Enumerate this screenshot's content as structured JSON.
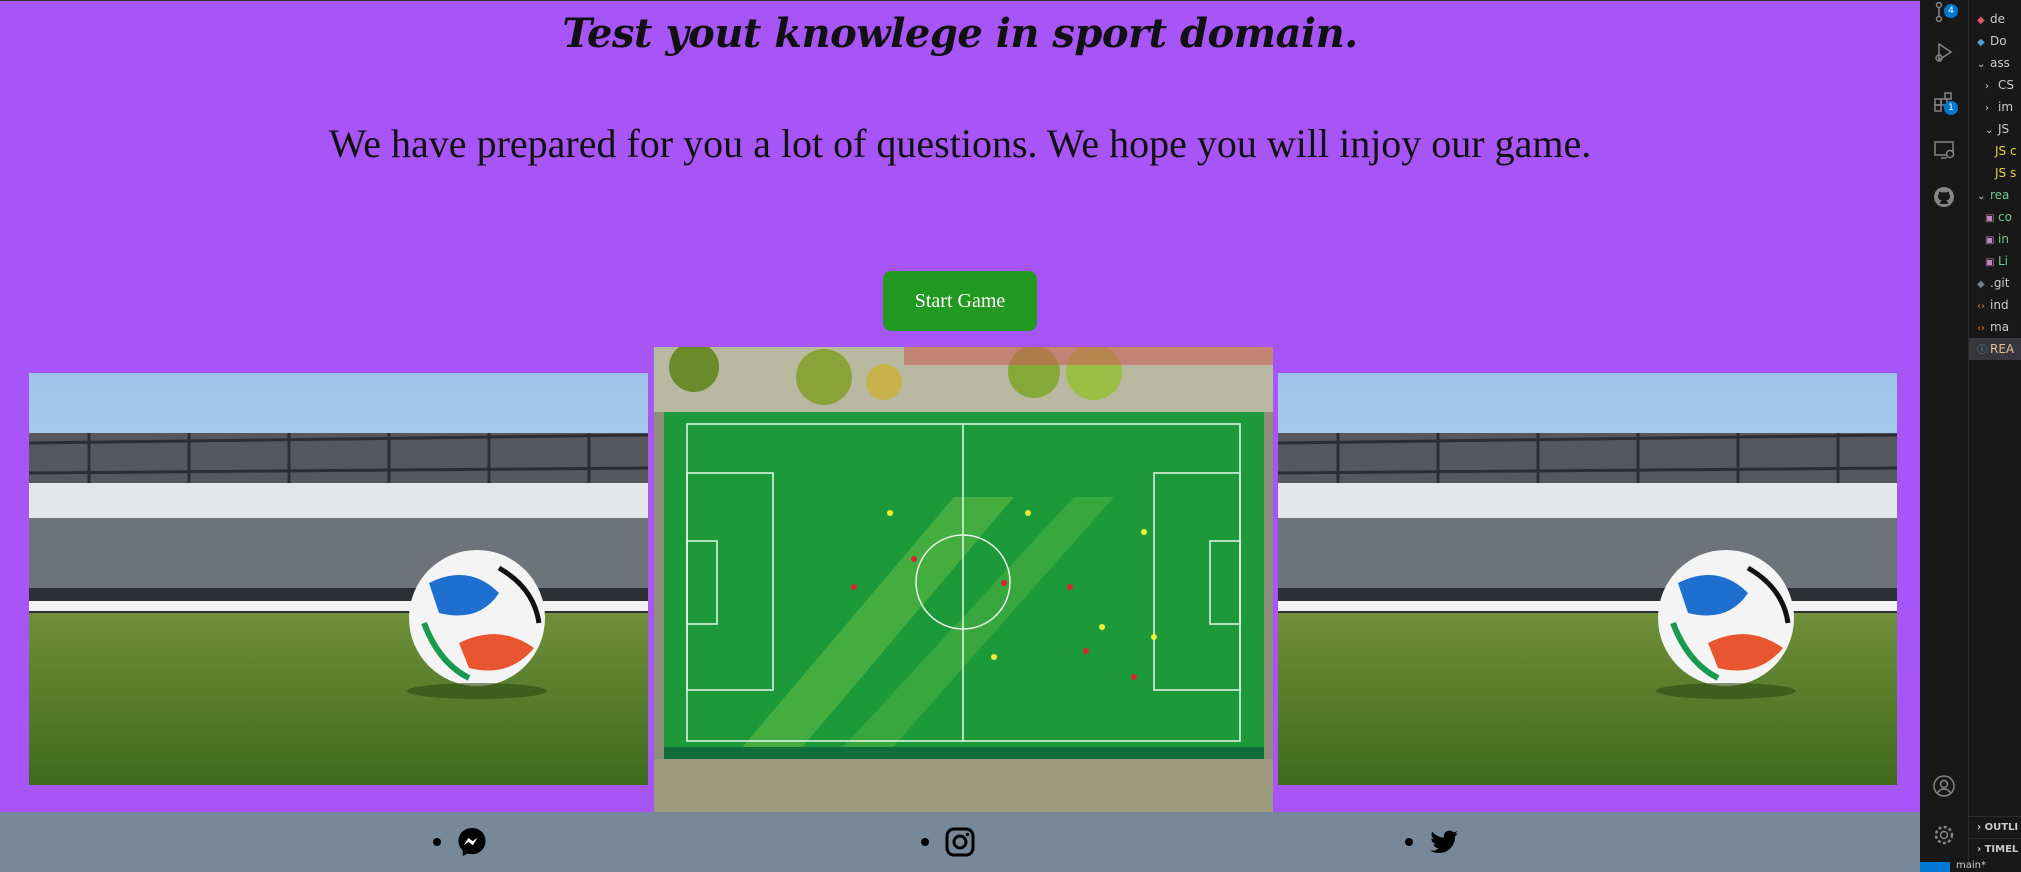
{
  "page": {
    "title": "Test yout knowlege in sport domain.",
    "subtitle": "We have prepared for you a lot of questions. We hope you will injoy our game.",
    "start_button": "Start Game",
    "background_color": "#a855f7",
    "button_color": "#229a22"
  },
  "images": [
    {
      "name": "stadium-ball-photo-left"
    },
    {
      "name": "aerial-football-field-photo"
    },
    {
      "name": "stadium-ball-photo-right"
    }
  ],
  "footer": {
    "background_color": "#778899",
    "links": [
      {
        "icon": "messenger-icon"
      },
      {
        "icon": "instagram-icon"
      },
      {
        "icon": "twitter-icon"
      }
    ]
  },
  "editor": {
    "activity_badges": {
      "source_control": "4",
      "extensions": "1"
    },
    "explorer_items": [
      {
        "label": "de"
      },
      {
        "label": "Do"
      },
      {
        "label": "ass"
      },
      {
        "label": "CS"
      },
      {
        "label": "im"
      },
      {
        "label": "JS"
      },
      {
        "label": "JS c"
      },
      {
        "label": "JS s"
      },
      {
        "label": "rea"
      },
      {
        "label": "co"
      },
      {
        "label": "in"
      },
      {
        "label": "Li"
      },
      {
        "label": ".git"
      },
      {
        "label": "ind"
      },
      {
        "label": "ma"
      },
      {
        "label": "REA"
      }
    ],
    "panels": [
      "OUTLI",
      "TIMEL"
    ],
    "status_branch": "main*"
  }
}
